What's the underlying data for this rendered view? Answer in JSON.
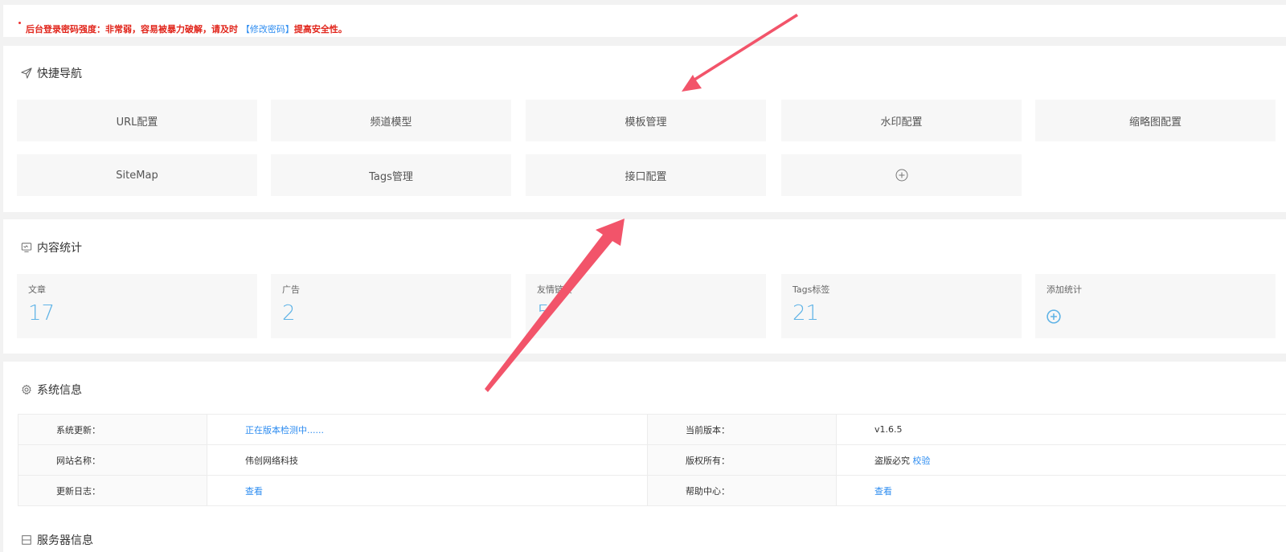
{
  "alert": {
    "prefix": "后台登录密码强度：非常弱，容易被暴力破解，请及时",
    "link": "【修改密码】",
    "suffix": "提高安全性。"
  },
  "quicknav": {
    "title": "快捷导航",
    "items": [
      "URL配置",
      "频道模型",
      "模板管理",
      "水印配置",
      "缩略图配置",
      "SiteMap",
      "Tags管理",
      "接口配置"
    ]
  },
  "stats": {
    "title": "内容统计",
    "items": [
      {
        "label": "文章",
        "value": "17"
      },
      {
        "label": "广告",
        "value": "2"
      },
      {
        "label": "友情链接",
        "value": "5"
      },
      {
        "label": "Tags标签",
        "value": "21"
      }
    ],
    "add_label": "添加统计"
  },
  "sysinfo": {
    "title": "系统信息",
    "rows": [
      {
        "k1": "系统更新：",
        "v1": "正在版本检测中......",
        "k2": "当前版本：",
        "v2": "v1.6.5"
      },
      {
        "k1": "网站名称：",
        "v1": "伟创网络科技",
        "k2": "版权所有：",
        "v2": "盗版必究",
        "v2link": "校验"
      },
      {
        "k1": "更新日志：",
        "v1": "查看",
        "k2": "帮助中心：",
        "v2": "查看"
      }
    ]
  },
  "server": {
    "title": "服务器信息"
  },
  "colors": {
    "alert": "#e1251b",
    "link": "#2d8cf0",
    "stat": "#5fb3e6",
    "arrow": "#f2546a"
  }
}
